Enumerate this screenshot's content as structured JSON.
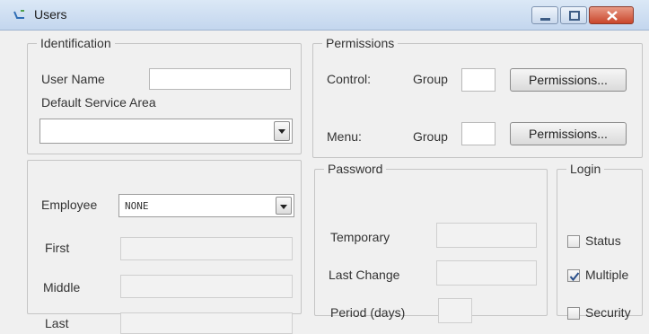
{
  "window": {
    "title": "Users"
  },
  "identification": {
    "legend": "Identification",
    "user_name_label": "User Name",
    "user_name_value": "",
    "default_service_area_label": "Default Service Area",
    "default_service_area_value": ""
  },
  "permissions": {
    "legend": "Permissions",
    "control_label": "Control:",
    "control_group_label": "Group",
    "control_group_value": "",
    "control_button": "Permissions...",
    "menu_label": "Menu:",
    "menu_group_label": "Group",
    "menu_group_value": "",
    "menu_button": "Permissions..."
  },
  "employee": {
    "label": "Employee",
    "selected": "NONE",
    "first_label": "First",
    "middle_label": "Middle",
    "last_label": "Last"
  },
  "password": {
    "legend": "Password",
    "temporary_label": "Temporary",
    "last_change_label": "Last Change",
    "period_label": "Period (days)"
  },
  "login": {
    "legend": "Login",
    "status_label": "Status",
    "status_checked": false,
    "multiple_label": "Multiple",
    "multiple_checked": true,
    "security_label": "Security",
    "security_checked": false
  }
}
